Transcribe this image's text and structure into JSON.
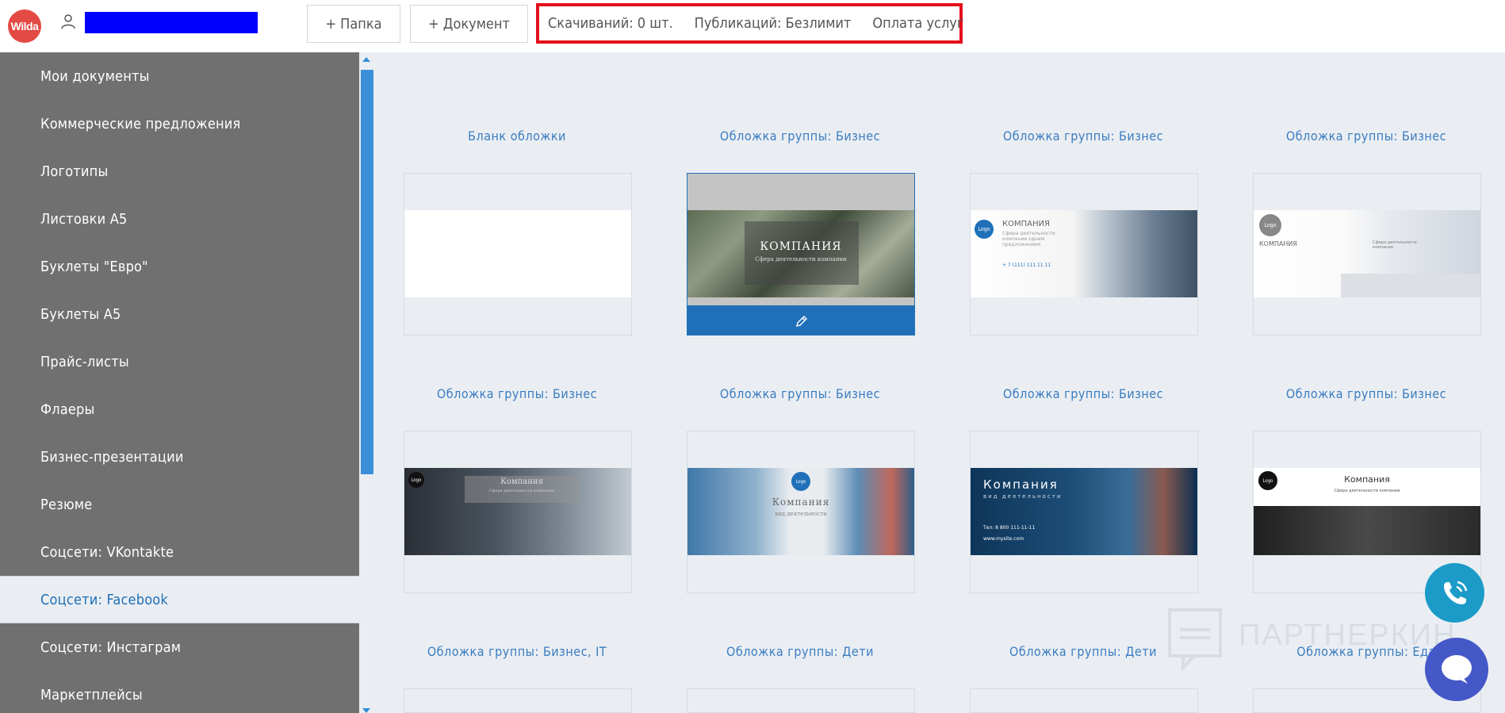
{
  "header": {
    "logo_text": "Wilda",
    "folder_button": "+ Папка",
    "document_button": "+ Документ",
    "downloads": "Скачиваний: 0 шт.",
    "publications": "Публикаций: Безлимит",
    "payment": "Оплата услуг"
  },
  "sidebar": {
    "items": [
      {
        "label": "Мои документы"
      },
      {
        "label": "Коммерческие предложения"
      },
      {
        "label": "Логотипы"
      },
      {
        "label": "Листовки А5"
      },
      {
        "label": "Буклеты \"Евро\""
      },
      {
        "label": "Буклеты А5"
      },
      {
        "label": "Прайс-листы"
      },
      {
        "label": "Флаеры"
      },
      {
        "label": "Бизнес-презентации"
      },
      {
        "label": "Резюме"
      },
      {
        "label": "Соцсети: VKontakte"
      },
      {
        "label": "Соцсети: Facebook"
      },
      {
        "label": "Соцсети: Инстаграм"
      },
      {
        "label": "Маркетплейсы"
      }
    ],
    "active": "Соцсети: Facebook"
  },
  "templates": [
    {
      "title": "Бланк обложки"
    },
    {
      "title": "Обложка группы: Бизнес",
      "caption": "КОМПАНИЯ",
      "sub": "Сфера деятельности компании"
    },
    {
      "title": "Обложка группы: Бизнес",
      "caption": "КОМПАНИЯ",
      "sub": "Сфера деятельности компании одним предложением",
      "phone": "+ 7 (111) 111 11 11"
    },
    {
      "title": "Обложка группы: Бизнес",
      "caption": "КОМПАНИЯ",
      "sub": "Сфера деятельности компании"
    },
    {
      "title": "Обложка группы: Бизнес",
      "caption": "Компания",
      "sub": "Сфера деятельности компании"
    },
    {
      "title": "Обложка группы: Бизнес",
      "caption": "Компания",
      "sub": "вид деятельности"
    },
    {
      "title": "Обложка группы: Бизнес",
      "caption": "Компания",
      "sub": "вид деятельности",
      "phone": "Тел: 8 800 111-11-11",
      "site": "www.mysite.com"
    },
    {
      "title": "Обложка группы: Бизнес",
      "caption": "Компания",
      "sub": "Сфера деятельности компании"
    },
    {
      "title": "Обложка группы: Бизнес, IT"
    },
    {
      "title": "Обложка группы: Дети"
    },
    {
      "title": "Обложка группы: Дети"
    },
    {
      "title": "Обложка группы: Еда"
    }
  ],
  "logo_badge": "Logo",
  "watermark": "ПАРТНЕРКИН",
  "icons": {
    "user": "user-icon",
    "edit": "pencil-icon",
    "call": "phone-icon",
    "chat": "chat-icon"
  },
  "colors": {
    "accent": "#1f70b8",
    "sidebar": "#707070",
    "highlight_border": "#e3101c",
    "logo": "#e34a43",
    "call": "#1c9bc8",
    "chat": "#4458c8"
  }
}
